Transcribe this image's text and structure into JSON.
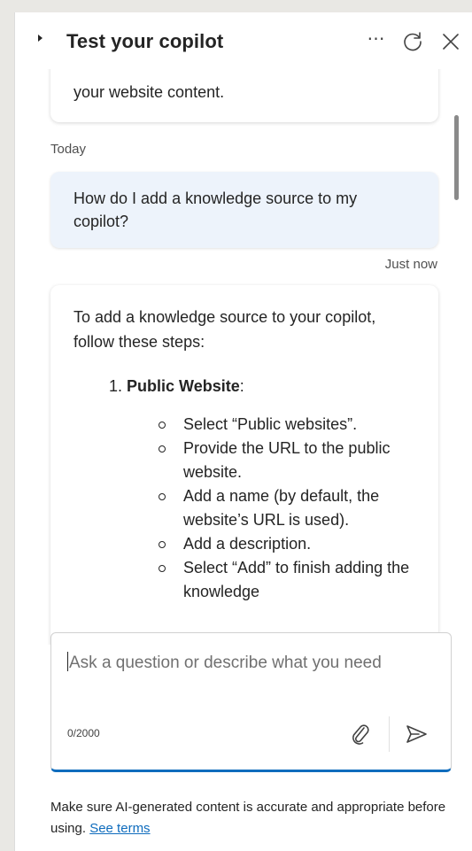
{
  "header": {
    "title": "Test your copilot",
    "more_icon": "more-horizontal-icon",
    "refresh_icon": "refresh-icon",
    "close_icon": "close-icon"
  },
  "chat": {
    "previous_message_tail": "your website content.",
    "day_label": "Today",
    "user_message": "How do I add a knowledge source to my copilot?",
    "user_timestamp": "Just now",
    "bot_intro": "To add a knowledge source to your copilot, follow these steps:",
    "step_number": "1.",
    "step_title": "Public Website",
    "step_suffix": ":",
    "substeps": [
      "Select “Public websites”.",
      "Provide the URL to the public website.",
      "Add a name (by default, the website’s URL is used).",
      "Add a description.",
      "Select “Add” to finish adding the knowledge"
    ]
  },
  "composer": {
    "placeholder": "Ask a question or describe what you need",
    "char_count": "0/2000",
    "attach_icon": "paperclip-icon",
    "send_icon": "send-icon"
  },
  "disclaimer": {
    "text": "Make sure AI-generated content is accurate and appropriate before using.",
    "link_label": "See terms"
  },
  "colors": {
    "accent": "#0f6cbd",
    "user_bubble": "#edf3fb",
    "page_background": "#e9e8e4"
  }
}
